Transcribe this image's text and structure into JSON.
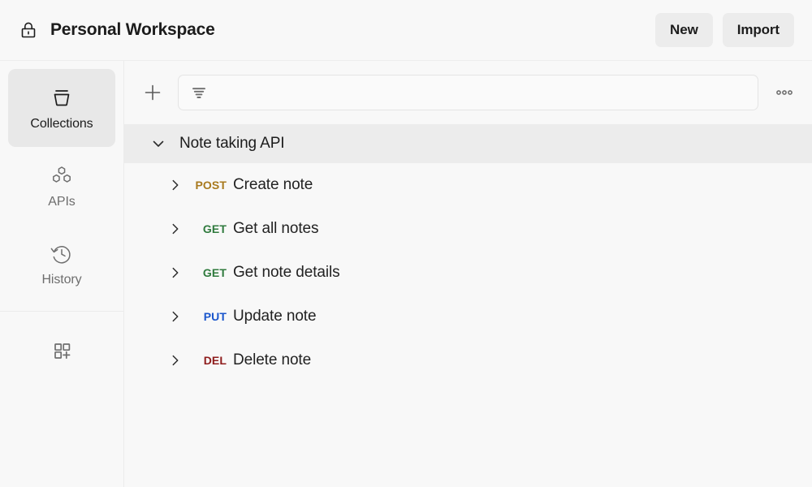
{
  "header": {
    "lock_icon": "lock-icon",
    "workspace_title": "Personal Workspace",
    "buttons": [
      {
        "label": "New",
        "name": "new-button"
      },
      {
        "label": "Import",
        "name": "import-button"
      }
    ]
  },
  "sidebar": {
    "items": [
      {
        "label": "Collections",
        "icon": "collections-icon",
        "active": true
      },
      {
        "label": "APIs",
        "icon": "apis-icon",
        "active": false
      },
      {
        "label": "History",
        "icon": "history-icon",
        "active": false
      }
    ],
    "footer_item": {
      "label": "",
      "icon": "add-apps-grid-icon"
    }
  },
  "toolbar": {
    "add_icon": "plus-icon",
    "filter_icon": "filter-icon",
    "search_value": "",
    "search_placeholder": "",
    "more_icon": "more-horizontal-icon"
  },
  "tree": {
    "collection": {
      "name": "Note taking API",
      "expanded": true,
      "chevron_icon": "chevron-down-icon"
    },
    "requests": [
      {
        "method": "POST",
        "method_class": "m-post",
        "name": "Create note",
        "chevron_icon": "chevron-right-icon"
      },
      {
        "method": "GET",
        "method_class": "m-get",
        "name": "Get all notes",
        "chevron_icon": "chevron-right-icon"
      },
      {
        "method": "GET",
        "method_class": "m-get",
        "name": "Get note details",
        "chevron_icon": "chevron-right-icon"
      },
      {
        "method": "PUT",
        "method_class": "m-put",
        "name": "Update note",
        "chevron_icon": "chevron-right-icon"
      },
      {
        "method": "DEL",
        "method_class": "m-del",
        "name": "Delete note",
        "chevron_icon": "chevron-right-icon"
      }
    ]
  },
  "colors": {
    "post": "#a8791d",
    "get": "#2f7a3d",
    "put": "#1a56cc",
    "del": "#8e1c1c",
    "page_bg": "#f8f8f8",
    "row_highlight": "#ececec",
    "button_bg": "#ececec"
  }
}
